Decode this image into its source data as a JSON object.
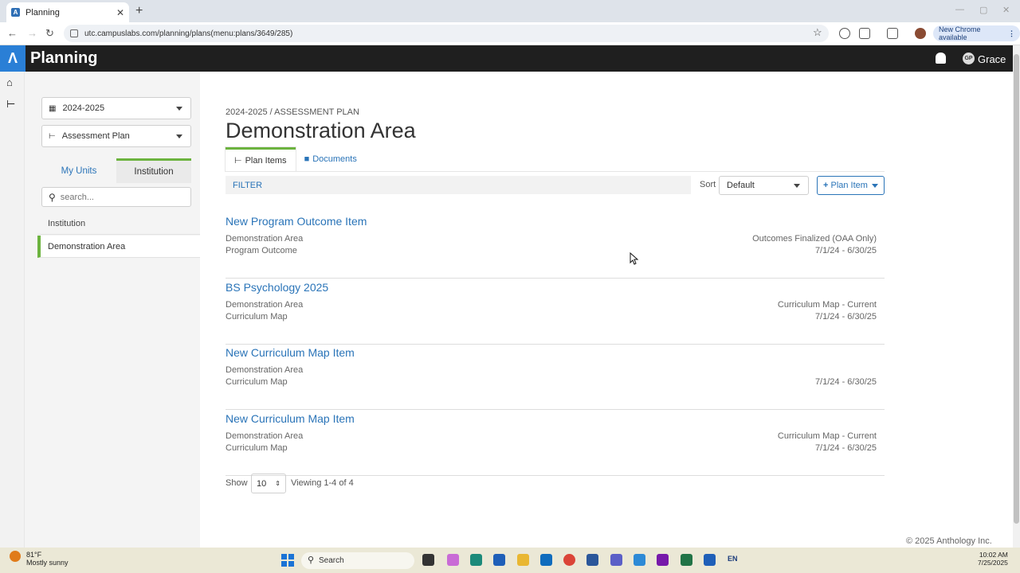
{
  "browser": {
    "tab_title": "Planning",
    "url": "utc.campuslabs.com/planning/plans(menu:plans/3649/285)",
    "new_chrome_label": "New Chrome available"
  },
  "app": {
    "title": "Planning",
    "user_initials": "GP",
    "user_name": "Grace"
  },
  "sidebar": {
    "year_select": "2024-2025",
    "plan_select": "Assessment Plan",
    "tabs": [
      {
        "label": "My Units"
      },
      {
        "label": "Institution"
      }
    ],
    "search_placeholder": "search...",
    "units": [
      {
        "label": "Institution"
      },
      {
        "label": "Demonstration Area"
      }
    ]
  },
  "main": {
    "breadcrumb": "2024-2025 / ASSESSMENT PLAN",
    "title": "Demonstration Area",
    "tabs": [
      {
        "label": "Plan Items"
      },
      {
        "label": "Documents"
      }
    ],
    "filter_label": "FILTER",
    "sort_label": "Sort",
    "sort_value": "Default",
    "add_button": "Plan Item",
    "items": [
      {
        "title": "New Program Outcome Item",
        "unit": "Demonstration Area",
        "type": "Program Outcome",
        "status": "Outcomes Finalized (OAA Only)",
        "dates": "7/1/24 - 6/30/25"
      },
      {
        "title": "BS Psychology 2025",
        "unit": "Demonstration Area",
        "type": "Curriculum Map",
        "status": "Curriculum Map - Current",
        "dates": "7/1/24 - 6/30/25"
      },
      {
        "title": "New Curriculum Map Item",
        "unit": "Demonstration Area",
        "type": "Curriculum Map",
        "status": "",
        "dates": "7/1/24 - 6/30/25"
      },
      {
        "title": "New Curriculum Map Item",
        "unit": "Demonstration Area",
        "type": "Curriculum Map",
        "status": "Curriculum Map - Current",
        "dates": "7/1/24 - 6/30/25"
      }
    ],
    "show_label": "Show",
    "page_size": "10",
    "viewing_text": "Viewing 1-4 of 4",
    "footer": "© 2025 Anthology Inc."
  },
  "taskbar": {
    "temperature": "81°F",
    "weather": "Mostly sunny",
    "search_label": "Search",
    "time": "10:02 AM",
    "date": "7/25/2025",
    "language": "EN"
  }
}
